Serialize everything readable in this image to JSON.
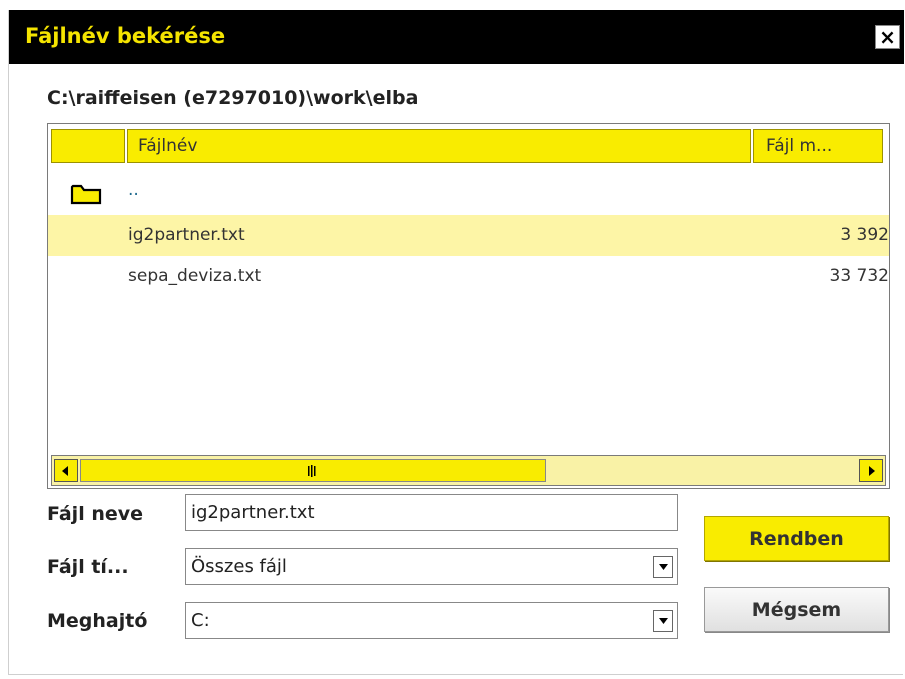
{
  "dialog": {
    "title": "Fájlnév bekérése",
    "close_glyph": "×",
    "path": "C:\\raiffeisen (e7297010)\\work\\elba"
  },
  "file_list": {
    "columns": [
      "",
      "Fájlnév",
      "Fájl m..."
    ],
    "rows": [
      {
        "icon": "folder-icon",
        "name": "..",
        "size": "",
        "selected": false
      },
      {
        "icon": "",
        "name": "ig2partner.txt",
        "size": "3 392",
        "selected": true
      },
      {
        "icon": "",
        "name": "sepa_deviza.txt",
        "size": "33 732",
        "selected": false
      }
    ]
  },
  "form": {
    "filename_label": "Fájl neve",
    "filename_value": "ig2partner.txt",
    "filetype_label": "Fájl tí...",
    "filetype_value": "Összes fájl",
    "drive_label": "Meghajtó",
    "drive_value": "C:"
  },
  "buttons": {
    "ok_label": "Rendben",
    "cancel_label": "Mégsem"
  },
  "colors": {
    "accent": "#f9ec00",
    "selected_row": "#fdf5a6",
    "titlebar": "#000000"
  }
}
